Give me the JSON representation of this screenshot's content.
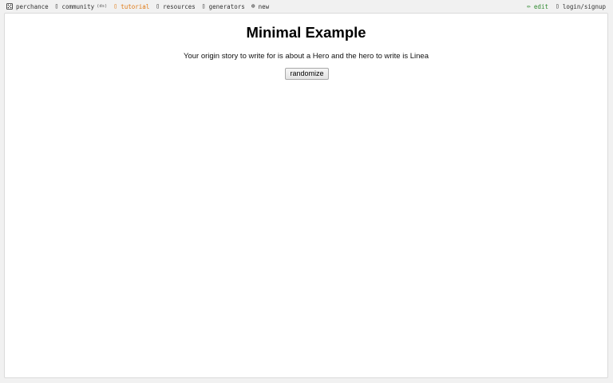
{
  "nav": {
    "brand": {
      "icon": "die-icon",
      "label": "perchance"
    },
    "community": {
      "icon": "chat-icon",
      "label": "community",
      "note": "(ds)"
    },
    "tutorial": {
      "icon": "book-icon",
      "label": "tutorial",
      "color": "#e07a16"
    },
    "resources": {
      "icon": "link-icon",
      "label": "resources"
    },
    "generators": {
      "icon": "list-icon",
      "label": "generators"
    },
    "new": {
      "icon": "plus-icon",
      "label": "new"
    },
    "edit": {
      "icon": "pencil-icon",
      "label": "edit",
      "color": "#2f8a2f"
    },
    "login": {
      "icon": "user-icon",
      "label": "login/signup"
    }
  },
  "main": {
    "title": "Minimal Example",
    "output": "Your origin story to write for is about a Hero and the hero to write is Linea",
    "randomize_label": "randomize"
  }
}
